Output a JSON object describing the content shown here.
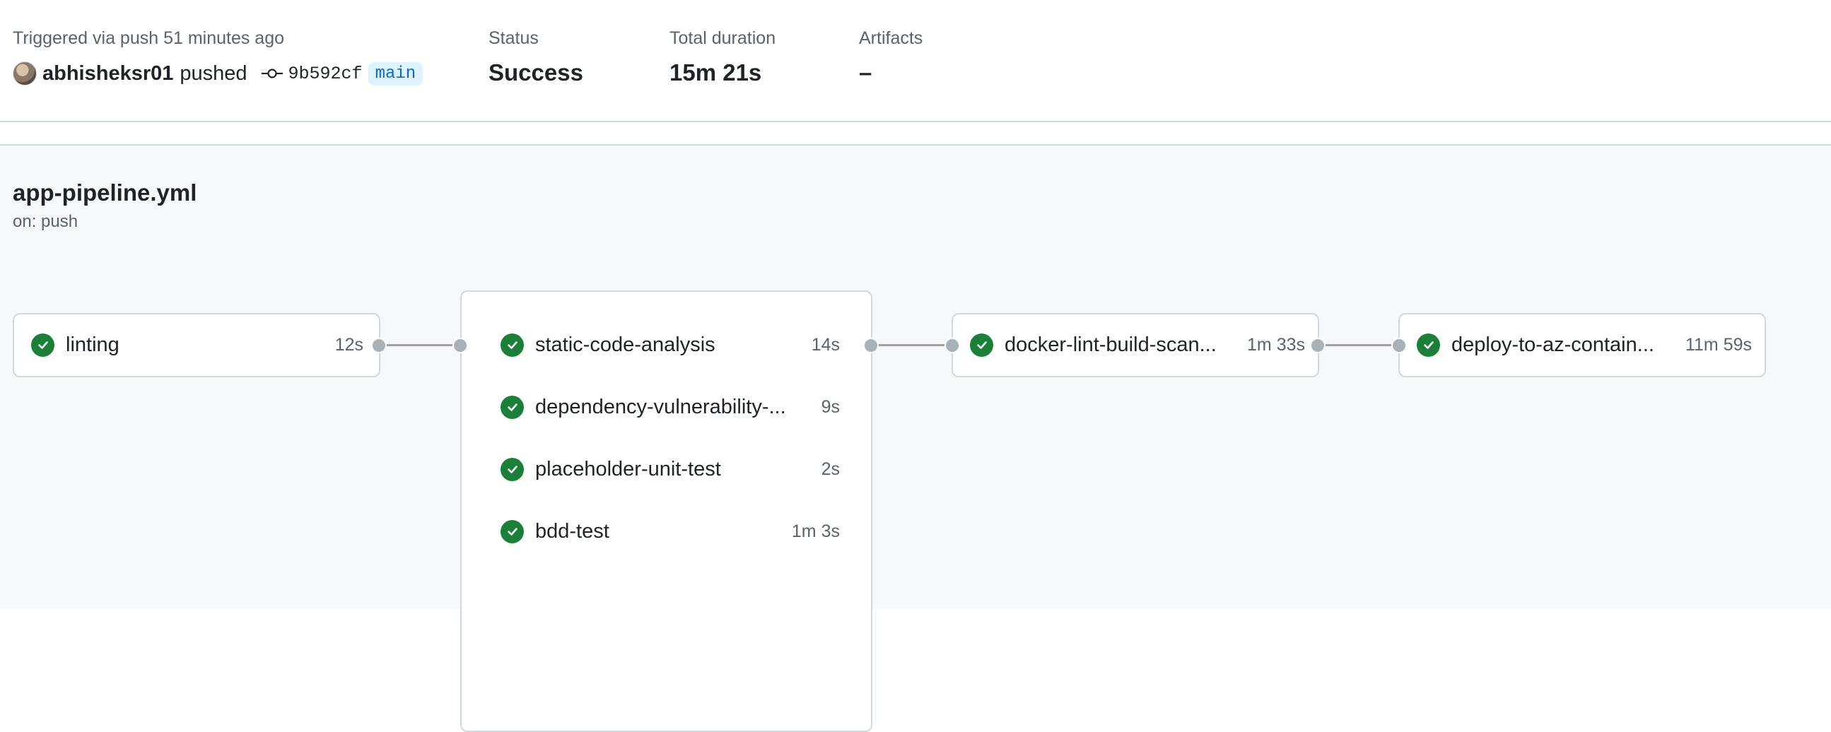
{
  "summary": {
    "triggered_text": "Triggered via push 51 minutes ago",
    "actor": "abhisheksr01",
    "action": "pushed",
    "commit_sha": "9b592cf",
    "branch": "main",
    "status_label": "Status",
    "status_value": "Success",
    "duration_label": "Total duration",
    "duration_value": "15m 21s",
    "artifacts_label": "Artifacts",
    "artifacts_value": "–"
  },
  "workflow": {
    "filename": "app-pipeline.yml",
    "trigger": "on: push",
    "stages": [
      {
        "jobs": [
          {
            "name": "linting",
            "duration": "12s",
            "status": "success"
          }
        ]
      },
      {
        "jobs": [
          {
            "name": "static-code-analysis",
            "duration": "14s",
            "status": "success"
          },
          {
            "name": "dependency-vulnerability-...",
            "duration": "9s",
            "status": "success"
          },
          {
            "name": "placeholder-unit-test",
            "duration": "2s",
            "status": "success"
          },
          {
            "name": "bdd-test",
            "duration": "1m 3s",
            "status": "success"
          }
        ]
      },
      {
        "jobs": [
          {
            "name": "docker-lint-build-scan...",
            "duration": "1m 33s",
            "status": "success"
          }
        ]
      },
      {
        "jobs": [
          {
            "name": "deploy-to-az-contain...",
            "duration": "11m 59s",
            "status": "success"
          }
        ]
      }
    ]
  },
  "colors": {
    "success": "#1a7f37",
    "branch_text": "#0969da",
    "branch_bg": "#ddf4ff",
    "graph_bg": "#f6f8fa"
  },
  "icons": [
    "avatar",
    "git-commit-icon",
    "check-circle-icon"
  ]
}
